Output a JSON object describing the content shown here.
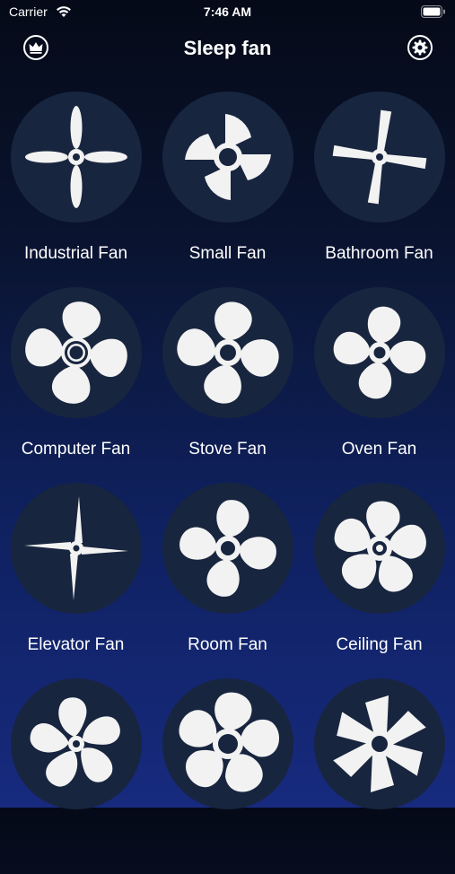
{
  "status": {
    "carrier": "Carrier",
    "time": "7:46 AM"
  },
  "header": {
    "title": "Sleep fan",
    "left_icon": "crown-icon",
    "right_icon": "gear-icon"
  },
  "fans": [
    {
      "label": "Industrial Fan",
      "icon": "industrial-fan-icon"
    },
    {
      "label": "Small Fan",
      "icon": "small-fan-icon"
    },
    {
      "label": "Bathroom Fan",
      "icon": "bathroom-fan-icon"
    },
    {
      "label": "Computer Fan",
      "icon": "computer-fan-icon"
    },
    {
      "label": "Stove Fan",
      "icon": "stove-fan-icon"
    },
    {
      "label": "Oven Fan",
      "icon": "oven-fan-icon"
    },
    {
      "label": "Elevator Fan",
      "icon": "elevator-fan-icon"
    },
    {
      "label": "Room Fan",
      "icon": "room-fan-icon"
    },
    {
      "label": "Ceiling Fan",
      "icon": "ceiling-fan-icon"
    },
    {
      "label": "",
      "icon": "fan-icon"
    },
    {
      "label": "",
      "icon": "fan-icon"
    },
    {
      "label": "",
      "icon": "fan-icon"
    }
  ],
  "colors": {
    "disc": "#18253f",
    "icon": "#f2f2f2"
  }
}
